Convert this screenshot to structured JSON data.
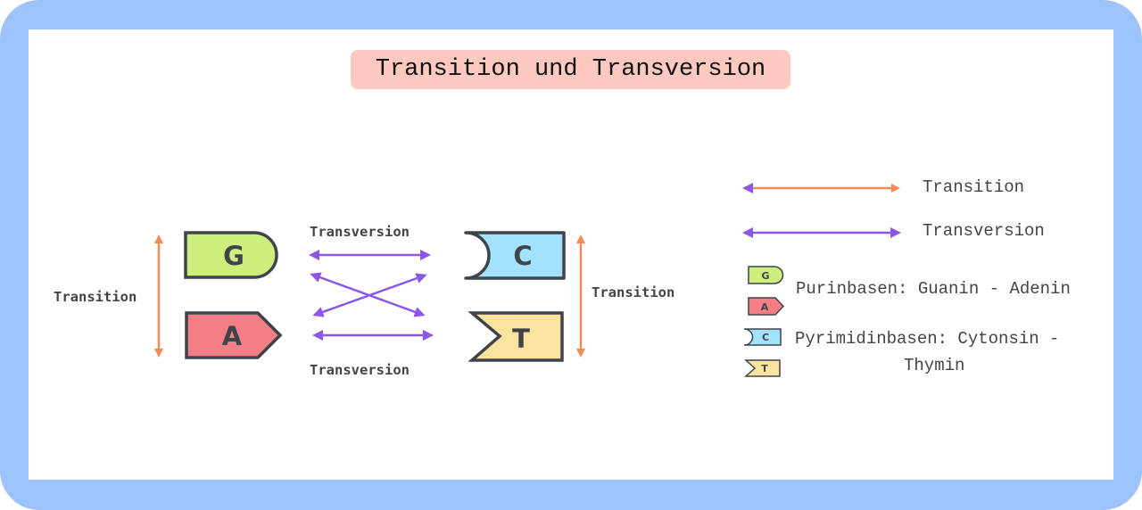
{
  "title": "Transition und Transversion",
  "colors": {
    "frame": "#9cc3fb",
    "title_bg": "#fdc9c1",
    "transition_arrow": "#f28b55",
    "transversion_arrow": "#8b57ea",
    "guanin": "#cdef7e",
    "adenin": "#f47e86",
    "cytosin": "#a3e2fd",
    "thymin": "#fde3a0",
    "outline": "#3f434a"
  },
  "bases": {
    "G": {
      "letter": "G",
      "name": "Guanin",
      "group": "purine"
    },
    "A": {
      "letter": "A",
      "name": "Adenin",
      "group": "purine"
    },
    "C": {
      "letter": "C",
      "name": "Cytonsin",
      "group": "pyrimidine"
    },
    "T": {
      "letter": "T",
      "name": "Thymin",
      "group": "pyrimidine"
    }
  },
  "diagram": {
    "left_transition_label": "Transition",
    "right_transition_label": "Transition",
    "top_transversion_label": "Transversion",
    "bottom_transversion_label": "Transversion"
  },
  "legend": {
    "transition_label": "Transition",
    "transversion_label": "Transversion",
    "purine_label": "Purinbasen: Guanin - Adenin",
    "pyrimidine_label_line1": "Pyrimidinbasen: Cytonsin -",
    "pyrimidine_label_line2": "Thymin"
  }
}
